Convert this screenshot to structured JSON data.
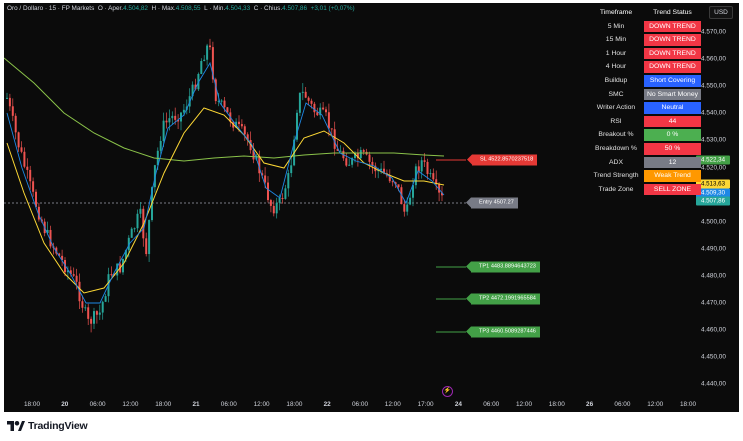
{
  "header": {
    "symbol": "Oro / Dollaro",
    "interval": "15",
    "source": "FP Markets",
    "open_label": "O",
    "open": "4.504,82",
    "high_label": "H",
    "high": "4.508,55",
    "low_label": "L",
    "low": "4.504,33",
    "close_label": "C",
    "close": "4.507,86",
    "change": "+3,01 (+0,07%)",
    "text_open_prefix": "Aper.",
    "text_high_prefix": "Max.",
    "text_low_prefix": "Min.",
    "text_close_prefix": "Chius."
  },
  "currency_button": "USD",
  "y_axis": {
    "ticks": [
      "4.570,00",
      "4.560,00",
      "4.550,00",
      "4.540,00",
      "4.530,00",
      "4.520,00",
      "4.510,00",
      "4.500,00",
      "4.490,00",
      "4.480,00",
      "4.470,00",
      "4.460,00",
      "4.450,00",
      "4.440,00"
    ],
    "badges": [
      {
        "text": "4.522,34",
        "color": "#43a047",
        "text_color": "#ffffff"
      },
      {
        "text": "4.513,63",
        "color": "#fdd835",
        "text_color": "#000000"
      },
      {
        "text": "4.509,30",
        "color": "#1e88e5",
        "text_color": "#ffffff"
      },
      {
        "text": "4.507,86",
        "color": "#26a69a",
        "text_color": "#ffffff"
      }
    ]
  },
  "x_axis": {
    "ticks": [
      {
        "label": "18:00",
        "bold": false
      },
      {
        "label": "20",
        "bold": true
      },
      {
        "label": "06:00",
        "bold": false
      },
      {
        "label": "12:00",
        "bold": false
      },
      {
        "label": "18:00",
        "bold": false
      },
      {
        "label": "21",
        "bold": true
      },
      {
        "label": "06:00",
        "bold": false
      },
      {
        "label": "12:00",
        "bold": false
      },
      {
        "label": "18:00",
        "bold": false
      },
      {
        "label": "22",
        "bold": true
      },
      {
        "label": "06:00",
        "bold": false
      },
      {
        "label": "12:00",
        "bold": false
      },
      {
        "label": "17:00",
        "bold": false
      },
      {
        "label": "24",
        "bold": true
      },
      {
        "label": "06:00",
        "bold": false
      },
      {
        "label": "12:00",
        "bold": false
      },
      {
        "label": "18:00",
        "bold": false
      },
      {
        "label": "26",
        "bold": true
      },
      {
        "label": "06:00",
        "bold": false
      },
      {
        "label": "12:00",
        "bold": false
      },
      {
        "label": "18:00",
        "bold": false
      }
    ]
  },
  "status_table": {
    "header": {
      "key": "Timeframe",
      "value": "Trend Status"
    },
    "rows": [
      {
        "key": "5 Min",
        "value": "DOWN TREND",
        "color": "#f23645"
      },
      {
        "key": "15 Min",
        "value": "DOWN TREND",
        "color": "#f23645"
      },
      {
        "key": "1 Hour",
        "value": "DOWN TREND",
        "color": "#f23645"
      },
      {
        "key": "4 Hour",
        "value": "DOWN TREND",
        "color": "#f23645"
      },
      {
        "key": "Buildup",
        "value": "Short Covering",
        "color": "#2962ff"
      },
      {
        "key": "SMC",
        "value": "No Smart Money",
        "color": "#787b86"
      },
      {
        "key": "Writer Action",
        "value": "Neutral",
        "color": "#2962ff"
      },
      {
        "key": "RSI",
        "value": "44",
        "color": "#f23645"
      },
      {
        "key": "Breakout %",
        "value": "0 %",
        "color": "#4caf50"
      },
      {
        "key": "Breakdown %",
        "value": "50 %",
        "color": "#f23645"
      },
      {
        "key": "ADX",
        "value": "12",
        "color": "#787b86"
      },
      {
        "key": "Trend Strength",
        "value": "Weak Trend",
        "color": "#ff9800"
      },
      {
        "key": "Trade Zone",
        "value": "SELL ZONE",
        "color": "#f23645"
      }
    ]
  },
  "levels": {
    "sl": "SL 4522.8570237518",
    "entry": "Entry 4507.27",
    "tp1": "TP1 4483.8894643723",
    "tp2": "TP2 4472.1991965584",
    "tp3": "TP3 4460.5089287446"
  },
  "colors": {
    "up": "#26a69a",
    "down": "#ef5350",
    "sl": "#e53935",
    "tp": "#43a047",
    "entry": "#787b86",
    "ma_long": "#8bc34a",
    "ma_mid": "#fdd835",
    "ma_fast": "#1e88e5"
  },
  "brand": {
    "name": "TradingView"
  }
}
